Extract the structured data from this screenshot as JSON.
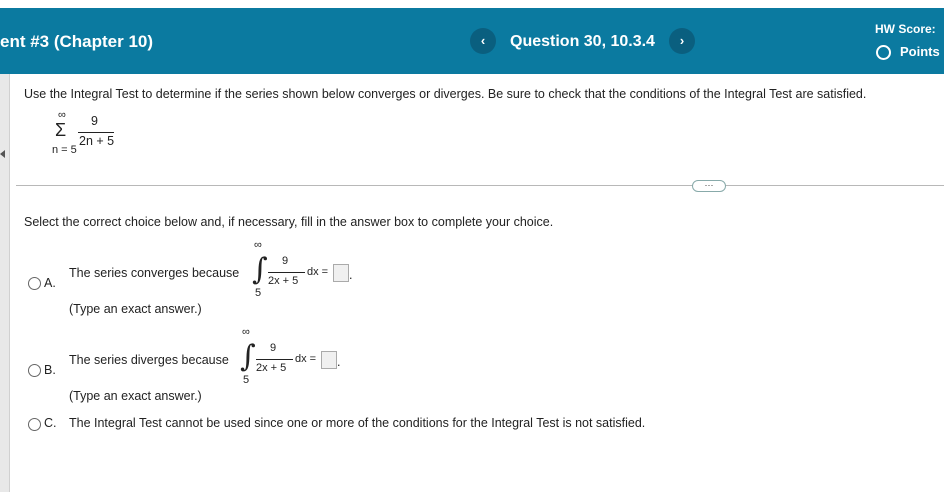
{
  "header": {
    "assignment_title": "ent #3 (Chapter 10)",
    "prev_icon": "‹",
    "next_icon": "›",
    "question_title": "Question 30, 10.3.4",
    "hw_score_label": "HW Score:",
    "points_label": "Points"
  },
  "question": {
    "instruction": "Use the Integral Test to determine if the series shown below converges or diverges. Be sure to check that the conditions of the Integral Test are satisfied.",
    "series": {
      "sigma": "Σ",
      "upper": "∞",
      "lower": "n = 5",
      "numerator": "9",
      "denominator": "2n + 5"
    }
  },
  "more_button": "···",
  "prompt": "Select the correct choice below and, if necessary, fill in the answer box to complete your choice.",
  "integral": {
    "sign": "∫",
    "upper": "∞",
    "lower": "5",
    "numerator": "9",
    "denominator": "2x + 5",
    "dx": "dx ="
  },
  "options": {
    "a": {
      "letter": "A.",
      "text": "The series converges because",
      "hint": "(Type an exact answer.)",
      "period": "."
    },
    "b": {
      "letter": "B.",
      "text": "The series diverges because",
      "hint": "(Type an exact answer.)",
      "period": "."
    },
    "c": {
      "letter": "C.",
      "text": "The Integral Test cannot be used since one or more of the conditions for the Integral Test is not satisfied."
    }
  }
}
